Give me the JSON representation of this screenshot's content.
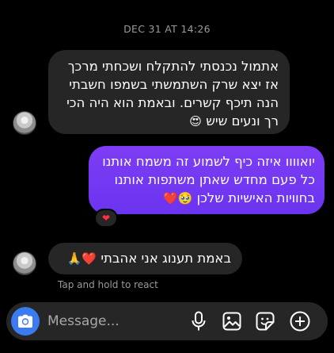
{
  "conversation": {
    "timestamp": "DEC 31 AT 14:26",
    "messages": [
      {
        "direction": "incoming",
        "lines": [
          "אתמול נכנסתי להתקלח ושכחתי מרכך",
          "אז יצא שרק השתמשתי בשמפו חשבתי",
          "הנה תיכף קשרים. ובאמת הוא היה הכי",
          "רך ונעים שיש"
        ],
        "emoji": "😍"
      },
      {
        "direction": "outgoing",
        "lines": [
          "יואוווו איזה כיף לשמוע זה משמח אותנו",
          "כל פעם מחדש שאתן משתפות אותנו",
          "בחוויות האישיות שלכן"
        ],
        "emoji": "🥹❤️",
        "reaction": "❤"
      },
      {
        "direction": "incoming",
        "text": "באמת תענוג אני אהבתי",
        "emoji": "❤️🙏"
      }
    ],
    "hint": "Tap and hold to react"
  },
  "composer": {
    "placeholder": "Message...",
    "value": "",
    "icons": [
      "camera-icon",
      "microphone-icon",
      "gallery-icon",
      "sticker-icon",
      "plus-icon"
    ]
  },
  "colors": {
    "background": "#000000",
    "incoming_bubble": "#262626",
    "outgoing_bubble": "#7239f2",
    "camera_button": "#3a7bf2",
    "reaction_heart": "#ff3040"
  }
}
